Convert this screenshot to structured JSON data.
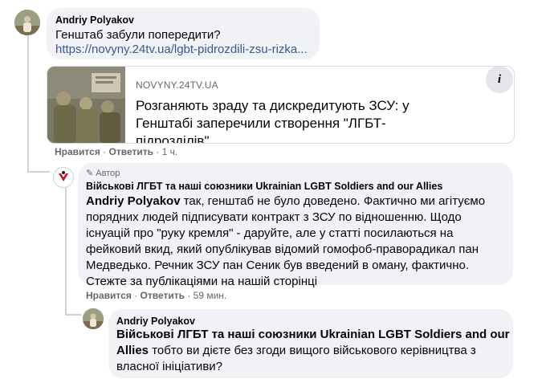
{
  "comment1": {
    "author": "Andriy Polyakov",
    "text": "Генштаб забули попередити?",
    "link": "https://novyny.24tv.ua/lgbt-pidrozdili-zsu-rizka..."
  },
  "preview": {
    "domain": "NOVYNY.24TV.UA",
    "title": "Розганяють зраду та дискредитують ЗСУ: у Генштабі заперечили створення \"ЛГБТ-підрозділів\"",
    "info_icon": "i"
  },
  "actions1": {
    "like": "Нравится",
    "sep": "·",
    "reply": "Ответить",
    "time": "1 ч."
  },
  "comment2": {
    "badge": "Автор",
    "author": "Військові ЛГБТ та наші союзники Ukrainian LGBT Soldiers and our Allies",
    "mention": "Andriy Polyakov",
    "text_lines": [
      " так, генштаб не було доведено. Фактично ми агітуємо",
      "порядних людей підписувати контракт з ЗСУ по відношенню. Щодо",
      "існуацій про \"руку кремля\" - даруйте, але у статті посилаються на",
      "фейковий вкид, який опублікував відомий гомофоб-праворадикал пан",
      "Медведько. Речник ЗСУ пан Сеник був введений в оману, фактично.",
      "Стежте за публікаціями на нашій сторінці"
    ]
  },
  "actions2": {
    "like": "Нравится",
    "sep": "·",
    "reply": "Ответить",
    "time": "59 мин."
  },
  "comment3": {
    "author": "Andriy Polyakov",
    "mention_line1": "Військові ЛГБТ та наші союзники Ukrainian LGBT Soldiers and our",
    "mention_line2": "Allies",
    "text_after": " тобто ви дієте без згоди вищого військового керівництва з",
    "text_line3": "власної ініціативи?"
  }
}
